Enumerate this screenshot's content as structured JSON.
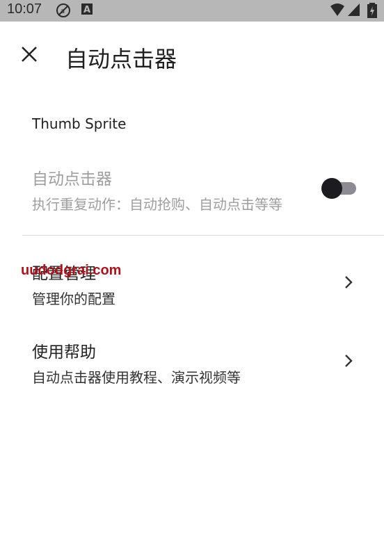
{
  "status_bar": {
    "time": "10:07"
  },
  "toolbar": {
    "title": "自动点击器",
    "close_icon": "close-icon"
  },
  "section": {
    "label": "Thumb Sprite"
  },
  "settings": [
    {
      "title": "自动点击器",
      "subtitle": "执行重复动作：自动抢购、自动点击等等",
      "control": "toggle",
      "enabled": false,
      "toggle_on": false
    },
    {
      "title": "配置管理",
      "subtitle": "管理你的配置",
      "control": "chevron-right-icon"
    },
    {
      "title": "使用帮助",
      "subtitle": "自动点击器使用教程、演示视频等",
      "control": "chevron-right-icon"
    }
  ],
  "watermark": "uudodgrai.com"
}
